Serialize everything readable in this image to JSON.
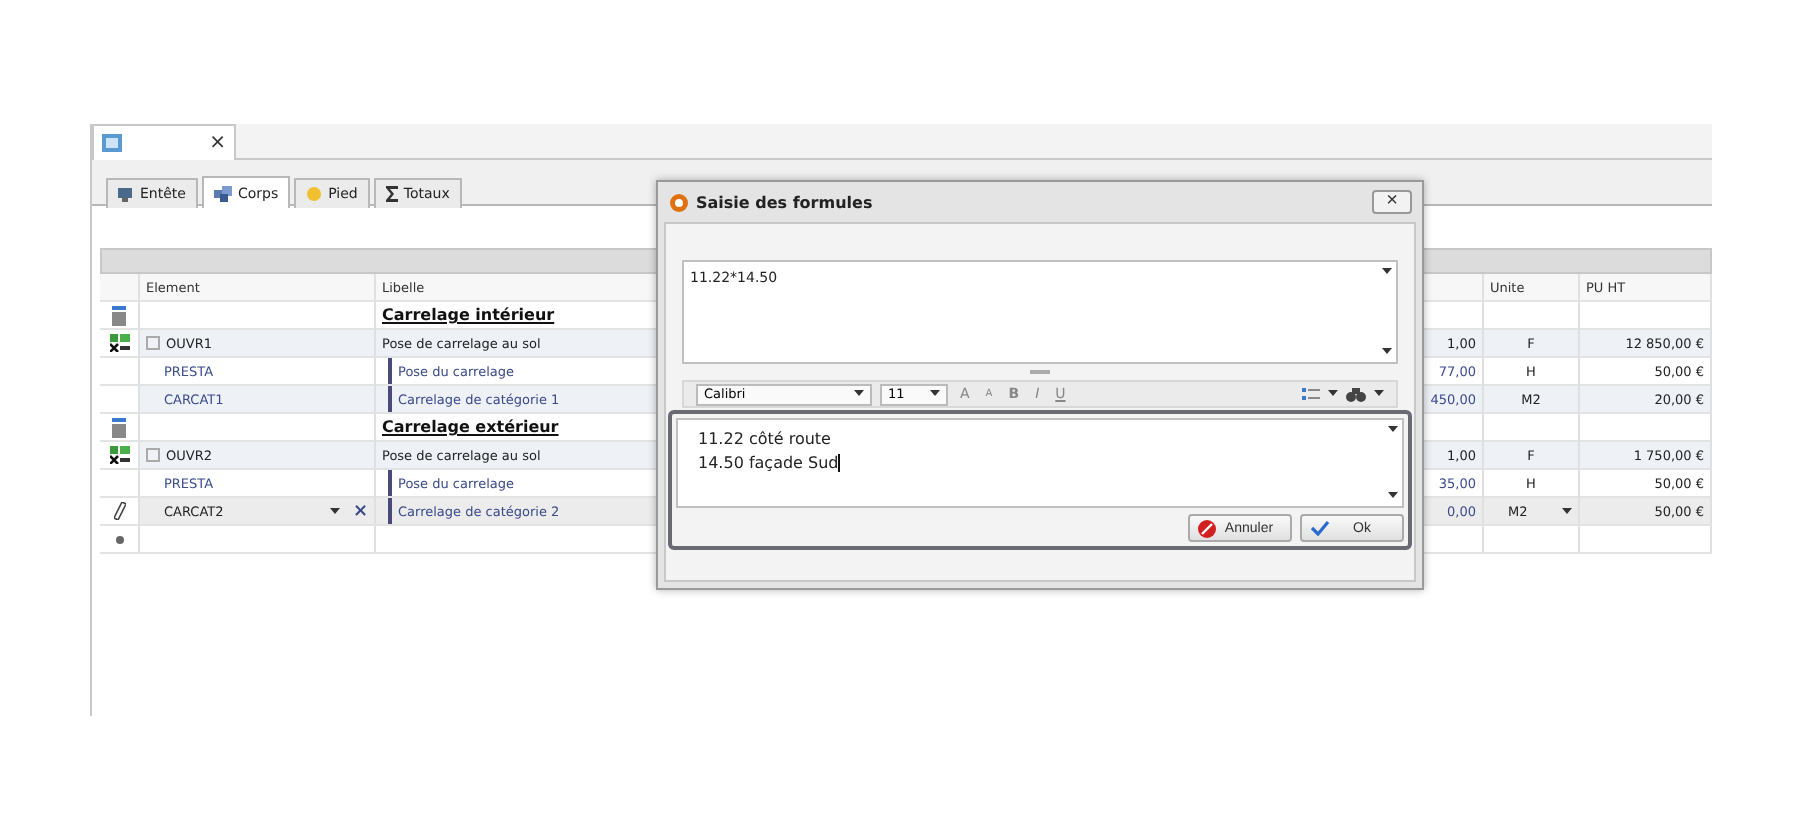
{
  "document_tab": {
    "close": "×"
  },
  "tabs": [
    {
      "label": "Entête",
      "kind": "header",
      "selected": false
    },
    {
      "label": "Corps",
      "kind": "body",
      "selected": true
    },
    {
      "label": "Pied",
      "kind": "footer",
      "selected": false
    },
    {
      "label": "Totaux",
      "kind": "totals",
      "selected": false
    }
  ],
  "grid": {
    "columns": [
      "Element",
      "Libelle",
      "Unite",
      "PU HT"
    ],
    "rows": [
      {
        "kind": "section",
        "libelle": "Carrelage intérieur"
      },
      {
        "kind": "work",
        "element": "OUVR1",
        "libelle": "Pose de carrelage au sol",
        "qty": "1,00",
        "unite": "F",
        "pu": "12 850,00 €"
      },
      {
        "kind": "item",
        "element": "PRESTA",
        "libelle": "Pose du carrelage",
        "qty": "77,00",
        "unite": "H",
        "pu": "50,00 €"
      },
      {
        "kind": "item",
        "element": "CARCAT1",
        "libelle": "Carrelage de catégorie 1",
        "qty": "450,00",
        "unite": "M2",
        "pu": "20,00 €"
      },
      {
        "kind": "section",
        "libelle": "Carrelage extérieur"
      },
      {
        "kind": "work",
        "element": "OUVR2",
        "libelle": "Pose de carrelage au sol",
        "qty": "1,00",
        "unite": "F",
        "pu": "1 750,00 €"
      },
      {
        "kind": "item",
        "element": "PRESTA",
        "libelle": "Pose du carrelage",
        "qty": "35,00",
        "unite": "H",
        "pu": "50,00 €"
      },
      {
        "kind": "edit",
        "element": "CARCAT2",
        "libelle": "Carrelage de catégorie 2",
        "qty": "0,00",
        "unite": "M2",
        "pu": "50,00 €",
        "clear": "×"
      },
      {
        "kind": "new"
      }
    ]
  },
  "dialog": {
    "title": "Saisie des formules",
    "close": "×",
    "formula": "11.22*14.50",
    "toolbar": {
      "font": "Calibri",
      "size": "11",
      "bold": "B",
      "italic": "I",
      "underline": "U",
      "grow": "A",
      "shrink": "A"
    },
    "comment_lines": [
      "11.22 côté route",
      "14.50 façade Sud"
    ],
    "buttons": [
      {
        "label": "Annuler",
        "kind": "cancel"
      },
      {
        "label": "Ok",
        "kind": "ok"
      }
    ]
  }
}
